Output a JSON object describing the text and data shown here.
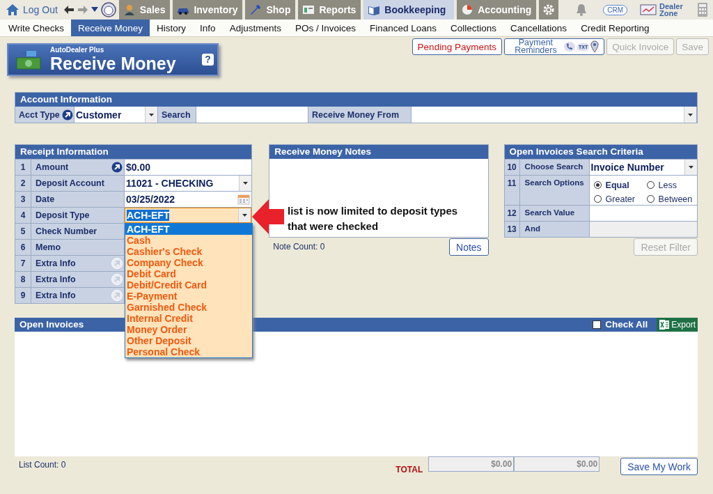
{
  "top_nav": {
    "logout": "Log Out",
    "tabs": [
      {
        "label": "Sales",
        "kind": "sales",
        "selected": false
      },
      {
        "label": "Inventory",
        "kind": "inventory",
        "selected": false
      },
      {
        "label": "Shop",
        "kind": "shop",
        "selected": false
      },
      {
        "label": "Reports",
        "kind": "reports",
        "selected": false
      },
      {
        "label": "Bookkeeping",
        "kind": "bookkeeping",
        "selected": true
      },
      {
        "label": "Accounting",
        "kind": "accounting",
        "selected": false
      }
    ],
    "crm": "CRM",
    "dealer_zone": "Dealer Zone"
  },
  "sub_nav": [
    {
      "label": "Write Checks",
      "selected": false
    },
    {
      "label": "Receive Money",
      "selected": true
    },
    {
      "label": "History",
      "selected": false
    },
    {
      "label": "Info",
      "selected": false
    },
    {
      "label": "Adjustments",
      "selected": false
    },
    {
      "label": "POs / Invoices",
      "selected": false
    },
    {
      "label": "Financed Loans",
      "selected": false
    },
    {
      "label": "Collections",
      "selected": false
    },
    {
      "label": "Cancellations",
      "selected": false
    },
    {
      "label": "Credit Reporting",
      "selected": false
    }
  ],
  "header": {
    "brand": "AutoDealer Plus",
    "title": "Receive Money",
    "help": "?"
  },
  "action_buttons": [
    {
      "label": "Pending Payments",
      "kind": "alert",
      "disabled": false
    },
    {
      "label": "Payment Reminders",
      "kind": "reminders",
      "disabled": false,
      "badge": "TXT"
    },
    {
      "label": "Quick Invoice",
      "kind": "plain",
      "disabled": true
    },
    {
      "label": "Save",
      "kind": "plain",
      "disabled": true
    }
  ],
  "account_info": {
    "title": "Account Information",
    "acct_type_label": "Acct Type",
    "acct_type_value": "Customer",
    "search_label": "Search",
    "receive_from_label": "Receive Money From"
  },
  "receipt": {
    "title": "Receipt Information",
    "rows": [
      {
        "number": "1",
        "label": "Amount",
        "kind": "input",
        "value": "$0.00",
        "action_button": {
          "disabled": false
        }
      },
      {
        "number": "2",
        "label": "Deposit Account",
        "kind": "select",
        "value": "11021 - CHECKING"
      },
      {
        "number": "3",
        "label": "Date",
        "kind": "date",
        "value": "03/25/2022"
      },
      {
        "number": "4",
        "label": "Deposit Type",
        "kind": "select",
        "value": "ACH-EFT",
        "open": true
      },
      {
        "number": "5",
        "label": "Check Number",
        "kind": "input"
      },
      {
        "number": "6",
        "label": "Memo",
        "kind": "input"
      },
      {
        "number": "7",
        "label": "Extra Info",
        "kind": "input",
        "action_button": {
          "disabled": true
        }
      },
      {
        "number": "8",
        "label": "Extra Info",
        "kind": "input",
        "action_button": {
          "disabled": true
        }
      },
      {
        "number": "9",
        "label": "Extra Info",
        "kind": "input",
        "action_button": {
          "disabled": true
        }
      }
    ]
  },
  "deposit_type_options": [
    {
      "label": "ACH-EFT",
      "selected": true
    },
    {
      "label": "Cash",
      "selected": false
    },
    {
      "label": "Cashier's Check",
      "selected": false
    },
    {
      "label": "Company Check",
      "selected": false
    },
    {
      "label": "Debit Card",
      "selected": false
    },
    {
      "label": "Debit/Credit Card",
      "selected": false
    },
    {
      "label": "E-Payment",
      "selected": false
    },
    {
      "label": "Garnished Check",
      "selected": false
    },
    {
      "label": "Internal Credit",
      "selected": false
    },
    {
      "label": "Money Order",
      "selected": false
    },
    {
      "label": "Other Deposit",
      "selected": false
    },
    {
      "label": "Personal Check",
      "selected": false
    }
  ],
  "annotation": "list is now limited to deposit types that were checked",
  "notes": {
    "title": "Receive Money Notes",
    "note_count": "Note Count: 0",
    "button": "Notes"
  },
  "search_criteria": {
    "title": "Open Invoices Search Criteria",
    "rows": [
      {
        "number": "10",
        "label": "Choose Search",
        "kind": "select",
        "value": "Invoice Number"
      },
      {
        "number": "11",
        "label": "Search Options",
        "kind": "radios",
        "options": [
          {
            "label": "Equal",
            "selected": true
          },
          {
            "label": "Less",
            "selected": false
          },
          {
            "label": "Greater",
            "selected": false
          },
          {
            "label": "Between",
            "selected": false
          }
        ]
      },
      {
        "number": "12",
        "label": "Search Value",
        "kind": "input"
      },
      {
        "number": "13",
        "label": "And",
        "kind": "disabled"
      }
    ],
    "reset_button": {
      "label": "Reset Filter",
      "disabled": true
    }
  },
  "open_invoices": {
    "title": "Open Invoices",
    "check_all": {
      "label": "Check All",
      "checked": false
    },
    "export": "Export",
    "list_count": "List Count: 0",
    "total_label": "TOTAL",
    "totals": [
      "$0.00",
      "$0.00"
    ],
    "save": "Save My Work"
  }
}
